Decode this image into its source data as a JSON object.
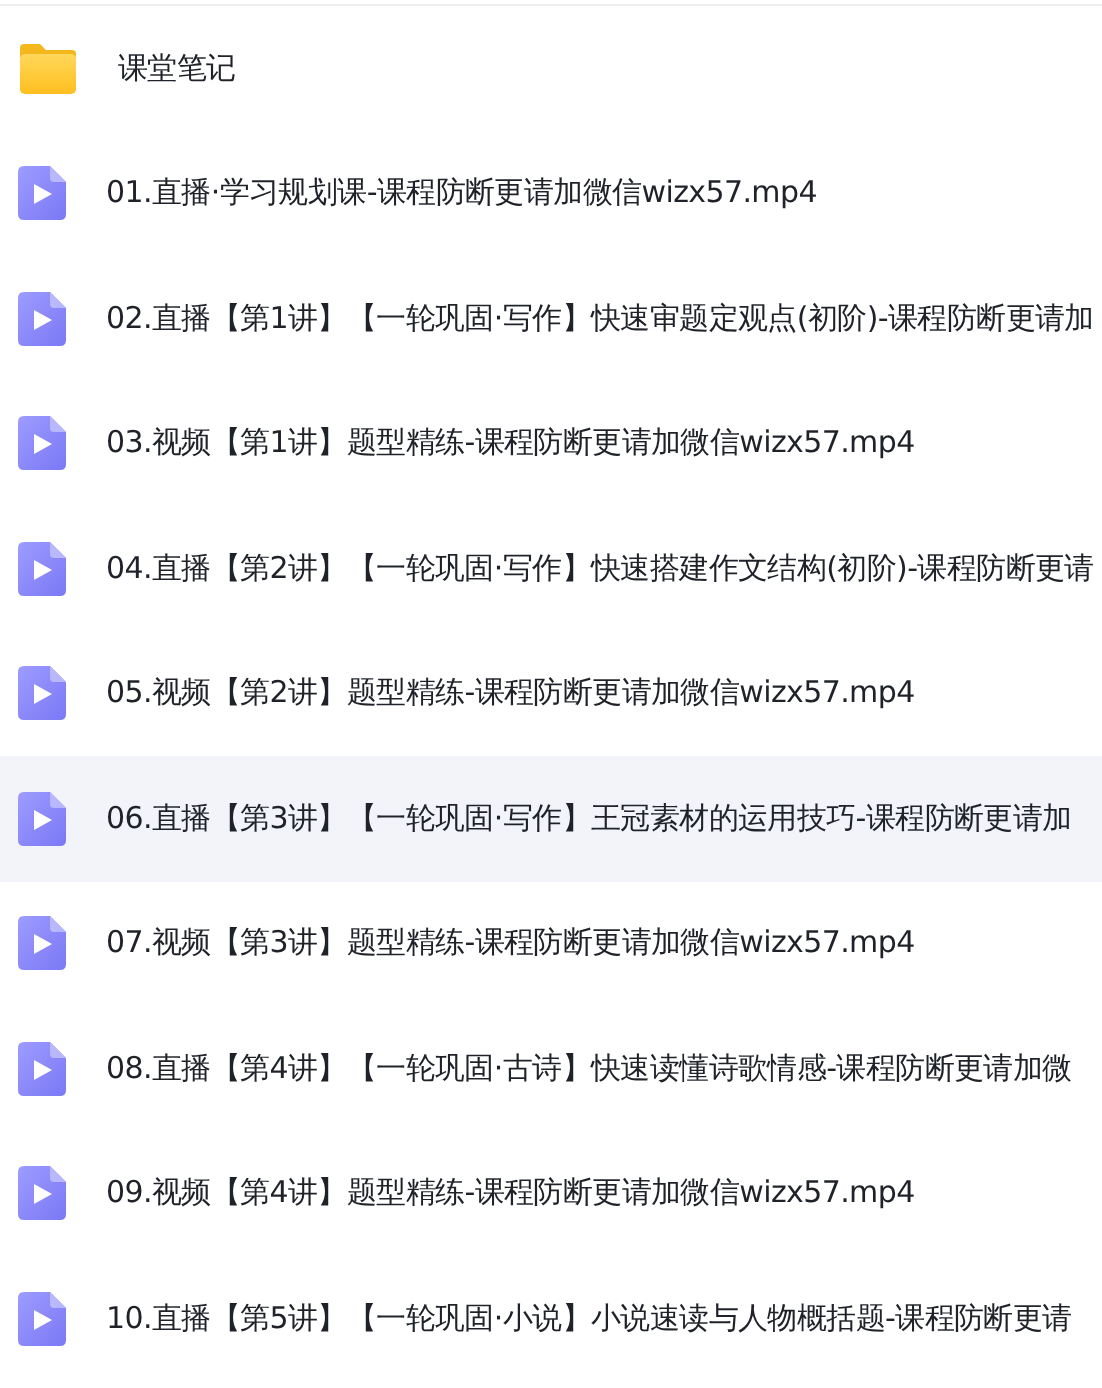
{
  "files": [
    {
      "kind": "folder",
      "name": "课堂笔记",
      "selected": false
    },
    {
      "kind": "video",
      "name": "01.直播·学习规划课-课程防断更请加微信wizx57.mp4",
      "selected": false
    },
    {
      "kind": "video",
      "name": "02.直播【第1讲】【一轮巩固·写作】快速审题定观点(初阶)-课程防断更请加",
      "selected": false
    },
    {
      "kind": "video",
      "name": "03.视频【第1讲】题型精练-课程防断更请加微信wizx57.mp4",
      "selected": false
    },
    {
      "kind": "video",
      "name": "04.直播【第2讲】【一轮巩固·写作】快速搭建作文结构(初阶)-课程防断更请",
      "selected": false
    },
    {
      "kind": "video",
      "name": "05.视频【第2讲】题型精练-课程防断更请加微信wizx57.mp4",
      "selected": false
    },
    {
      "kind": "video",
      "name": "06.直播【第3讲】【一轮巩固·写作】王冠素材的运用技巧-课程防断更请加",
      "selected": true
    },
    {
      "kind": "video",
      "name": "07.视频【第3讲】题型精练-课程防断更请加微信wizx57.mp4",
      "selected": false
    },
    {
      "kind": "video",
      "name": "08.直播【第4讲】【一轮巩固·古诗】快速读懂诗歌情感-课程防断更请加微",
      "selected": false
    },
    {
      "kind": "video",
      "name": "09.视频【第4讲】题型精练-课程防断更请加微信wizx57.mp4",
      "selected": false
    },
    {
      "kind": "video",
      "name": "10.直播【第5讲】【一轮巩固·小说】小说速读与人物概括题-课程防断更请",
      "selected": false
    }
  ]
}
